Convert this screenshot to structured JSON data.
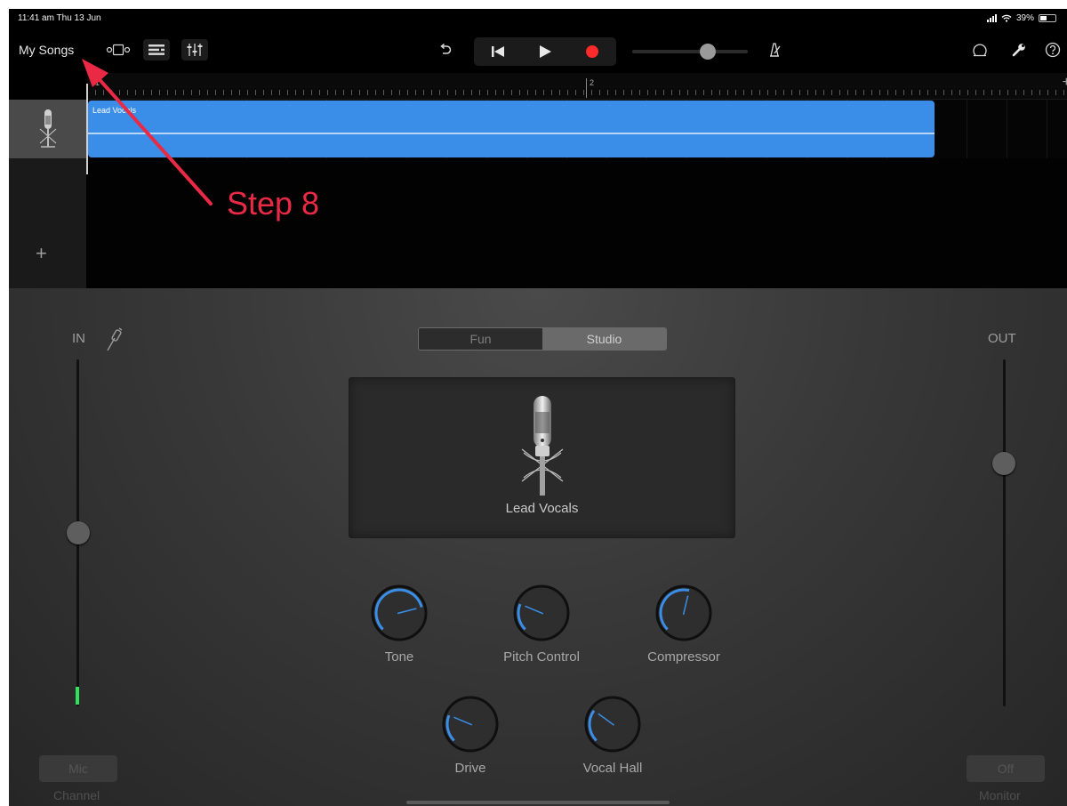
{
  "status_bar": {
    "time": "11:41 am  Thu 13 Jun",
    "battery": "39%"
  },
  "toolbar": {
    "my_songs": "My Songs",
    "icons": [
      "browser-icon",
      "tracks-view-icon",
      "mixer-icon",
      "undo-icon",
      "rewind-icon",
      "play-icon",
      "record-icon",
      "metronome-icon",
      "loop-icon",
      "settings-icon",
      "help-icon"
    ],
    "record_color": "#ff2a2a",
    "master_volume": 0.65
  },
  "ruler": {
    "bar_1": "1",
    "bar_2": "2"
  },
  "tracks": [
    {
      "region_name": "Lead Vocals",
      "region_color": "#3a8ee8"
    }
  ],
  "panel": {
    "in_label": "IN",
    "out_label": "OUT",
    "in_level": 0.5,
    "out_level": 0.7,
    "mode_tabs": [
      "Fun",
      "Studio"
    ],
    "selected_mode": "Studio",
    "preset_name": "Lead Vocals",
    "knobs": [
      {
        "label": "Tone",
        "value": 0.78
      },
      {
        "label": "Pitch Control",
        "value": 0.25
      },
      {
        "label": "Compressor",
        "value": 0.55
      },
      {
        "label": "Drive",
        "value": 0.25
      },
      {
        "label": "Vocal Hall",
        "value": 0.3
      }
    ],
    "input_button": "Mic",
    "input_caption": "Channel",
    "monitor_button": "Off",
    "monitor_caption": "Monitor"
  },
  "annotation": {
    "label": "Step 8",
    "color": "#ea2a45"
  }
}
